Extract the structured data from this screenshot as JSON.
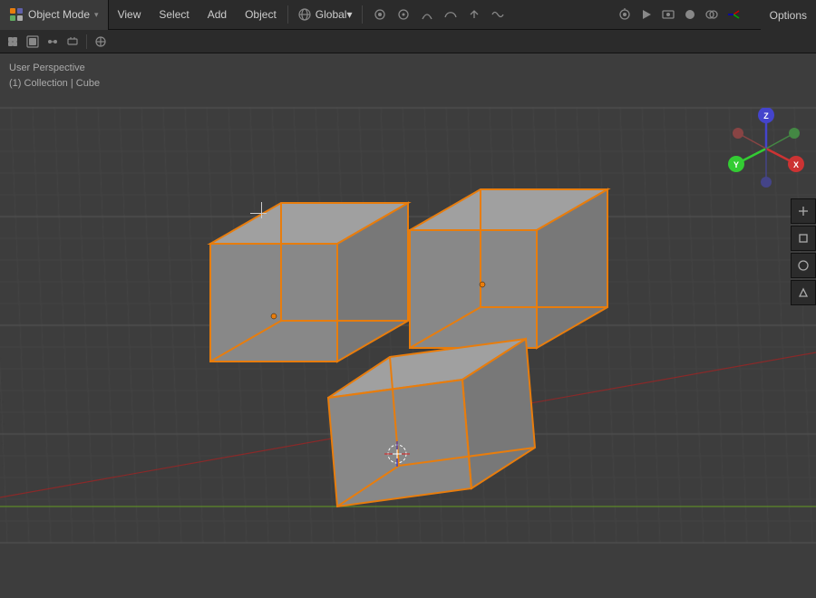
{
  "topbar": {
    "mode_label": "Object Mode",
    "menu_items": [
      "View",
      "Select",
      "Add",
      "Object"
    ],
    "global_label": "Global",
    "options_label": "Options"
  },
  "viewport": {
    "perspective_label": "User Perspective",
    "collection_label": "(1) Collection | Cube"
  },
  "icons": {
    "chevron": "▾",
    "cursor_icon": "⊕"
  }
}
